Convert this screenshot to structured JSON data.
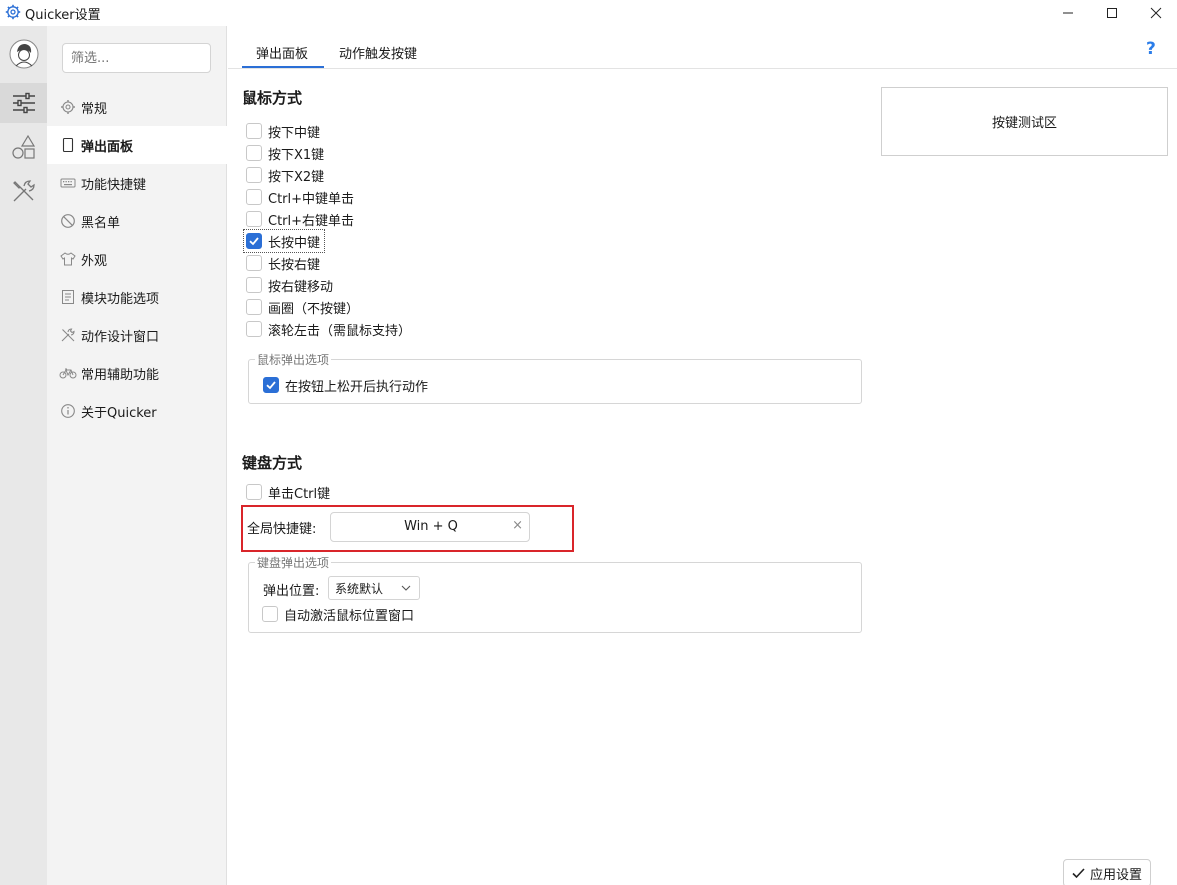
{
  "window": {
    "title": "Quicker设置",
    "icon": "gear-icon",
    "controls": [
      "minimize-icon",
      "maximize-icon",
      "close-icon"
    ]
  },
  "rail": {
    "items": [
      "avatar",
      "sliders-icon",
      "shapes-icon",
      "tools-icon"
    ]
  },
  "nav": {
    "filter_placeholder": "筛选...",
    "items": [
      {
        "label": "常规",
        "icon": "gear-icon"
      },
      {
        "label": "弹出面板",
        "icon": "panel-icon"
      },
      {
        "label": "功能快捷键",
        "icon": "keyboard-icon"
      },
      {
        "label": "黑名单",
        "icon": "blocked-icon"
      },
      {
        "label": "外观",
        "icon": "shirt-icon"
      },
      {
        "label": "模块功能选项",
        "icon": "module-icon"
      },
      {
        "label": "动作设计窗口",
        "icon": "tools-icon"
      },
      {
        "label": "常用辅助功能",
        "icon": "bicycle-icon"
      },
      {
        "label": "关于Quicker",
        "icon": "info-icon"
      }
    ],
    "active_index": 1
  },
  "tabs": {
    "items": [
      "弹出面板",
      "动作触发按键"
    ],
    "active_index": 0,
    "help": "?"
  },
  "mouse_section": {
    "title": "鼠标方式",
    "options": [
      {
        "label": "按下中键",
        "checked": false
      },
      {
        "label": "按下X1键",
        "checked": false
      },
      {
        "label": "按下X2键",
        "checked": false
      },
      {
        "label": "Ctrl+中键单击",
        "checked": false
      },
      {
        "label": "Ctrl+右键单击",
        "checked": false
      },
      {
        "label": "长按中键",
        "checked": true
      },
      {
        "label": "长按右键",
        "checked": false
      },
      {
        "label": "按右键移动",
        "checked": false
      },
      {
        "label": "画圈（不按键）",
        "checked": false
      },
      {
        "label": "滚轮左击（需鼠标支持）",
        "checked": false
      }
    ],
    "popup_group": {
      "legend": "鼠标弹出选项",
      "option": {
        "label": "在按钮上松开后执行动作",
        "checked": true
      }
    }
  },
  "keytest": {
    "label": "按键测试区"
  },
  "keyboard_section": {
    "title": "键盘方式",
    "single_ctrl": {
      "label": "单击Ctrl键",
      "checked": false
    },
    "hotkey": {
      "label": "全局快捷键:",
      "value": "Win + Q",
      "clear": "×"
    },
    "popup_group": {
      "legend": "键盘弹出选项",
      "position_label": "弹出位置:",
      "position_value": "系统默认",
      "auto_activate": {
        "label": "自动激活鼠标位置窗口",
        "checked": false
      }
    }
  },
  "footer": {
    "apply_label": "应用设置"
  },
  "colors": {
    "accent": "#2b6fd6",
    "highlight_frame": "#d9252a",
    "help": "#2b7de9"
  }
}
